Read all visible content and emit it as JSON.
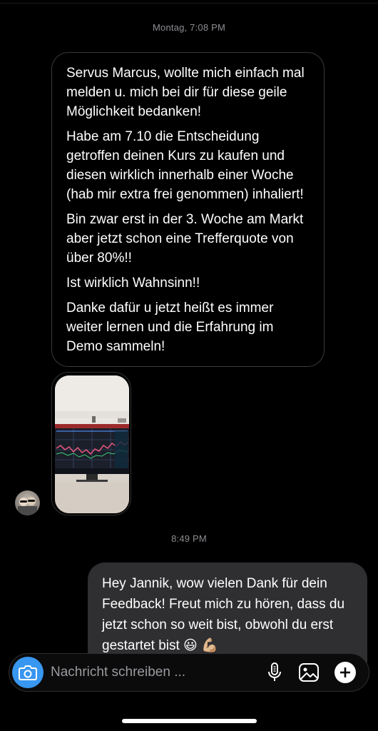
{
  "thread": {
    "timestamp_1": "Montag, 7:08 PM",
    "timestamp_2": "8:49 PM"
  },
  "incoming_message": {
    "paragraphs": [
      "Servus Marcus, wollte mich einfach mal melden u. mich bei dir für diese geile Möglichkeit bedanken!",
      "Habe am 7.10 die Entscheidung getroffen deinen Kurs zu kaufen und diesen wirklich innerhalb einer Woche (hab mir extra frei genommen) inhaliert!",
      "Bin zwar erst in der 3. Woche am Markt aber jetzt schon eine Trefferquote von über 80%!!",
      "Ist wirklich Wahnsinn!!",
      "Danke dafür u jetzt heißt es immer weiter lernen und die Erfahrung im Demo sammeln!"
    ]
  },
  "outgoing_message": {
    "text": "Hey Jannik, wow vielen Dank für dein Feedback! Freut mich zu hören, dass du jetzt schon so weit bist, obwohl du erst gestartet bist 😃 💪🏼"
  },
  "composer": {
    "placeholder": "Nachricht schreiben ...",
    "icons": [
      "camera-icon",
      "microphone-icon",
      "gallery-icon",
      "plus-icon"
    ]
  },
  "colors": {
    "accent": "#3897f0",
    "outgoing_bubble": "#2f2f31",
    "incoming_border": "#3a3a3c",
    "timestamp": "#8e8e93"
  }
}
